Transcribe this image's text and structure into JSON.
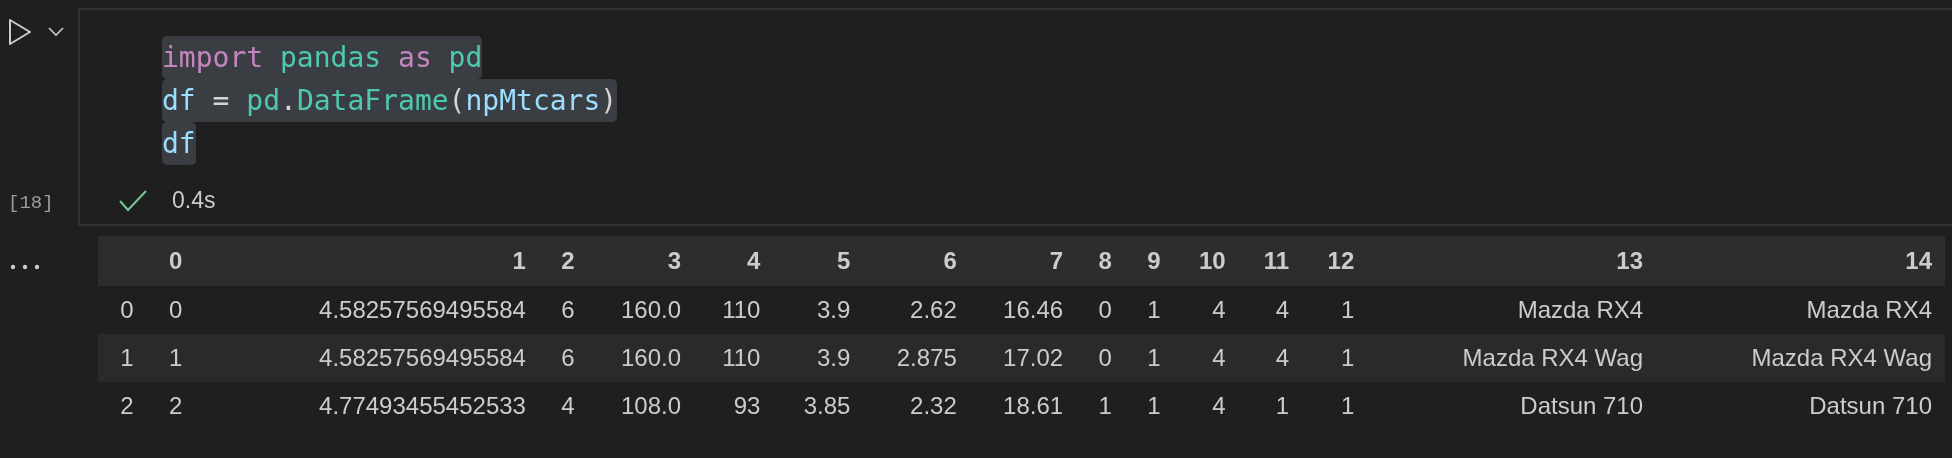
{
  "cell": {
    "execution_count": "[18]",
    "code_lines": [
      [
        {
          "kind": "keyword",
          "text": "import "
        },
        {
          "kind": "module",
          "text": "pandas "
        },
        {
          "kind": "keyword",
          "text": "as "
        },
        {
          "kind": "module",
          "text": "pd"
        }
      ],
      [
        {
          "kind": "variable",
          "text": "df"
        },
        {
          "kind": "plain",
          "text": " = "
        },
        {
          "kind": "module",
          "text": "pd"
        },
        {
          "kind": "plain",
          "text": "."
        },
        {
          "kind": "module",
          "text": "DataFrame"
        },
        {
          "kind": "plain",
          "text": "("
        },
        {
          "kind": "variable",
          "text": "npMtcars"
        },
        {
          "kind": "plain",
          "text": ")"
        }
      ],
      [
        {
          "kind": "variable",
          "text": "df"
        }
      ]
    ],
    "status": {
      "succeeded": true,
      "duration": "0.4s"
    }
  },
  "output": {
    "table": {
      "columns": [
        "0",
        "1",
        "2",
        "3",
        "4",
        "5",
        "6",
        "7",
        "8",
        "9",
        "10",
        "11",
        "12",
        "13",
        "14"
      ],
      "rows": [
        {
          "index": "0",
          "cells": [
            "0",
            "4.58257569495584",
            "6",
            "160.0",
            "110",
            "3.9",
            "2.62",
            "16.46",
            "0",
            "1",
            "4",
            "4",
            "1",
            "Mazda RX4",
            "Mazda RX4"
          ]
        },
        {
          "index": "1",
          "cells": [
            "1",
            "4.58257569495584",
            "6",
            "160.0",
            "110",
            "3.9",
            "2.875",
            "17.02",
            "0",
            "1",
            "4",
            "4",
            "1",
            "Mazda RX4 Wag",
            "Mazda RX4 Wag"
          ]
        },
        {
          "index": "2",
          "cells": [
            "2",
            "4.77493455452533",
            "4",
            "108.0",
            "93",
            "3.85",
            "2.32",
            "18.61",
            "1",
            "1",
            "4",
            "1",
            "1",
            "Datsun 710",
            "Datsun 710"
          ]
        }
      ]
    }
  }
}
